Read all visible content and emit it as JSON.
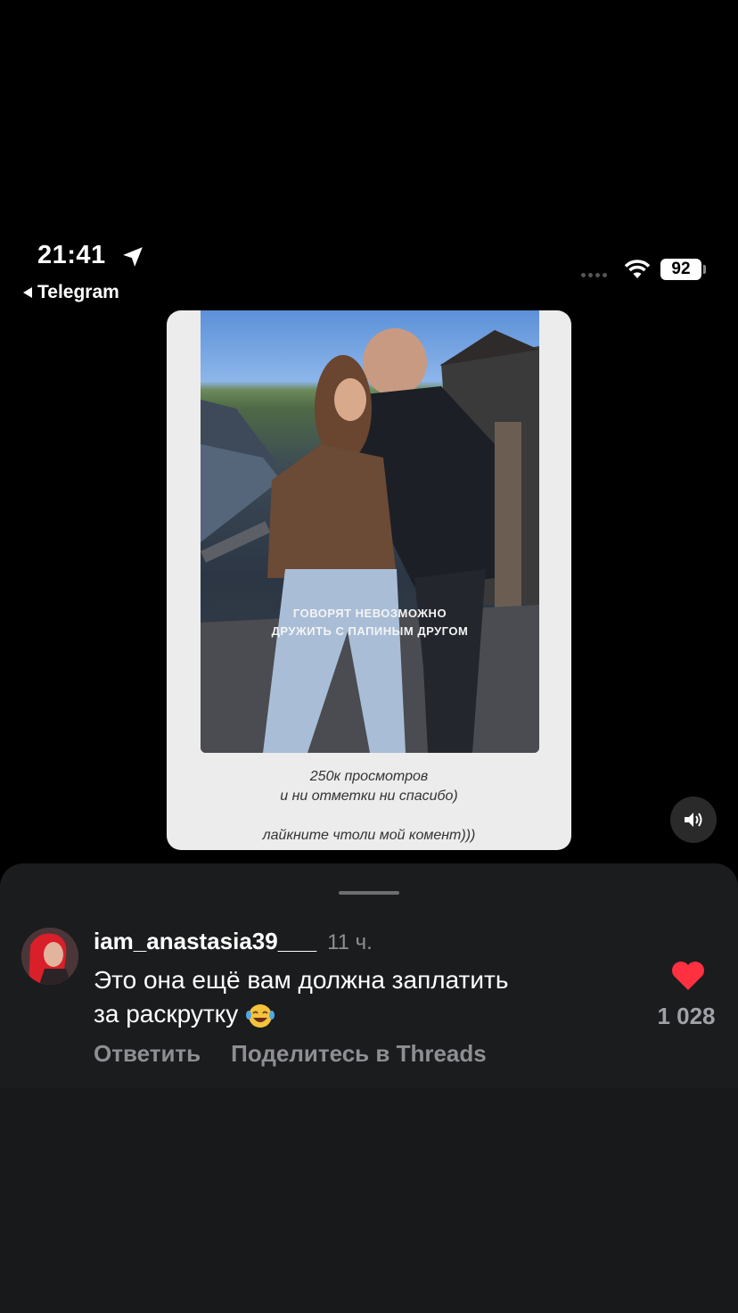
{
  "status_bar": {
    "time": "21:41",
    "back_label": "Telegram",
    "battery": "92",
    "location_icon": "location-arrow-icon",
    "wifi_icon": "wifi-icon"
  },
  "post": {
    "overlay_line1": "ГОВОРЯТ НЕВОЗМОЖНО",
    "overlay_line2": "ДРУЖИТЬ С ПАПИНЫМ ДРУГОМ",
    "caption_line1": "250к просмотров",
    "caption_line2": "и ни отметки ни спасибо)",
    "caption_line3": "лайкните чтоли мой комент)))"
  },
  "comment": {
    "username": "iam_anastasia39___",
    "time_ago": "11 ч.",
    "text_line1": "Это она ещё вам  должна заплатить",
    "text_line2": "за раскрутку",
    "emoji": "😂",
    "reply_label": "Ответить",
    "share_label": "Поделитесь в Threads",
    "likes": "1 028",
    "heart_color": "#ff3040"
  }
}
